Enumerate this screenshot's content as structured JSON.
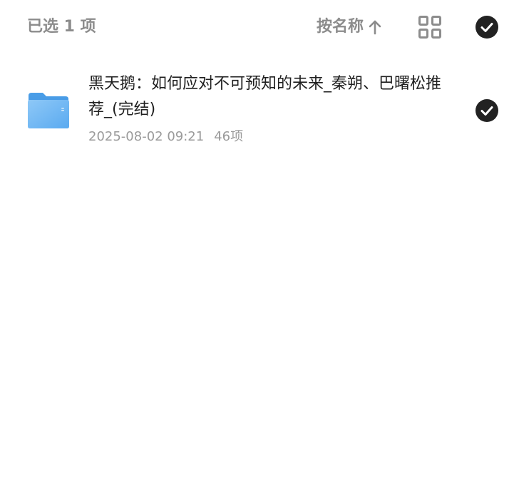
{
  "toolbar": {
    "selected_text": "已选 1 项",
    "sort_label": "按名称",
    "sort_icon": "arrow-up-icon",
    "view_icon": "grid-view-icon",
    "select_all_icon": "check-circle-icon",
    "select_all_checked": true
  },
  "files": [
    {
      "type": "folder",
      "icon": "folder-icon",
      "name": "黑天鹅：如何应对不可预知的未来_秦朔、巴曙松推荐_(完结)",
      "date": "2025-08-02 09:21",
      "count": "46项",
      "selected": true,
      "check_icon": "check-circle-icon"
    }
  ],
  "colors": {
    "background": "#ffffff",
    "muted_text": "#8c8c8c",
    "primary_text": "#1f1f1f",
    "check_fill": "#222222",
    "folder_blue": "#5aaaf0"
  }
}
